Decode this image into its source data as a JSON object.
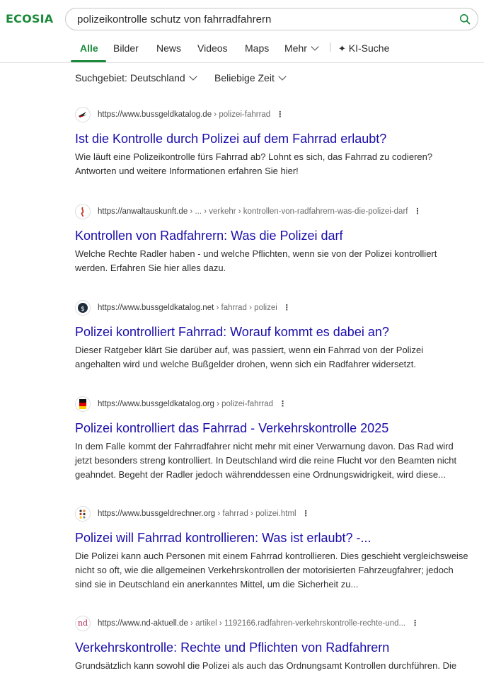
{
  "header": {
    "logo": "ECOSIA",
    "query": "polizeikontrolle schutz von fahrradfahrern"
  },
  "nav": {
    "tabs": [
      "Alle",
      "Bilder",
      "News",
      "Videos",
      "Maps",
      "Mehr",
      "KI-Suche"
    ],
    "active": "Alle"
  },
  "filters": {
    "region_label": "Suchgebiet:",
    "region_value": "Deutschland",
    "time": "Beliebige Zeit"
  },
  "colors": {
    "brand": "#1a8a3a",
    "link": "#1a0dab"
  },
  "results": [
    {
      "domain": "https://www.bussgeldkatalog.de",
      "path": " › polizei-fahrrad",
      "title": "Ist die Kontrolle durch Polizei auf dem Fahrrad erlaubt?",
      "snippet": "Wie läuft eine Polizeikontrolle fürs Fahrrad ab? Lohnt es sich, das Fahrrad zu codieren? Antworten und weitere Informationen erfahren Sie hier!",
      "favicon": "bird-logo-icon"
    },
    {
      "domain": "https://anwaltauskunft.de",
      "path": " › ... › verkehr › kontrollen-von-radfahrern-was-die-polizei-darf",
      "title": "Kontrollen von Radfahrern: Was die Polizei darf",
      "snippet": "Welche Rechte Radler haben - und welche Pflichten, wenn sie von der Polizei kontrolliert werden. Erfahren Sie hier alles dazu.",
      "favicon": "red-swirl-icon"
    },
    {
      "domain": "https://www.bussgeldkatalog.net",
      "path": " › fahrrad › polizei",
      "title": "Polizei kontrolliert Fahrrad: Worauf kommt es dabei an?",
      "snippet": "Dieser Ratgeber klärt Sie darüber auf, was passiert, wenn ein Fahrrad von der Polizei angehalten wird und welche Bußgelder drohen, wenn sich ein Radfahrer widersetzt.",
      "favicon": "dark-badge-icon"
    },
    {
      "domain": "https://www.bussgeldkatalog.org",
      "path": " › polizei-fahrrad",
      "title": "Polizei kontrolliert das Fahrrad - Verkehrskontrolle 2025",
      "snippet": "In dem Falle kommt der Fahrradfahrer nicht mehr mit einer Verwarnung davon. Das Rad wird jetzt besonders streng kontrolliert. In Deutschland wird die reine Flucht vor den Beamten nicht geahndet. Begeht der Radler jedoch währenddessen eine Ordnungswidrigkeit, wird diese...",
      "favicon": "german-flag-icon"
    },
    {
      "domain": "https://www.bussgeldrechner.org",
      "path": " › fahrrad › polizei.html",
      "title": "Polizei will Fahrrad kontrollieren: Was ist erlaubt? -...",
      "snippet": "Die Polizei kann auch Personen mit einem Fahrrad kontrollieren. Dies geschieht vergleichsweise nicht so oft, wie die allgemeinen Verkehrskontrollen der motorisierten Fahrzeugfahrer; jedoch sind sie in Deutschland ein anerkanntes Mittel, um die Sicherheit zu...",
      "favicon": "dot-grid-icon"
    },
    {
      "domain": "https://www.nd-aktuell.de",
      "path": " › artikel › 1192166.radfahren-verkehrskontrolle-rechte-und...",
      "title": "Verkehrskontrolle: Rechte und Pflichten von Radfahrern",
      "snippet": "Grundsätzlich kann sowohl die Polizei als auch das Ordnungsamt Kontrollen durchführen. Die",
      "favicon": "nd-logo-icon",
      "favicon_text": "nd"
    }
  ]
}
